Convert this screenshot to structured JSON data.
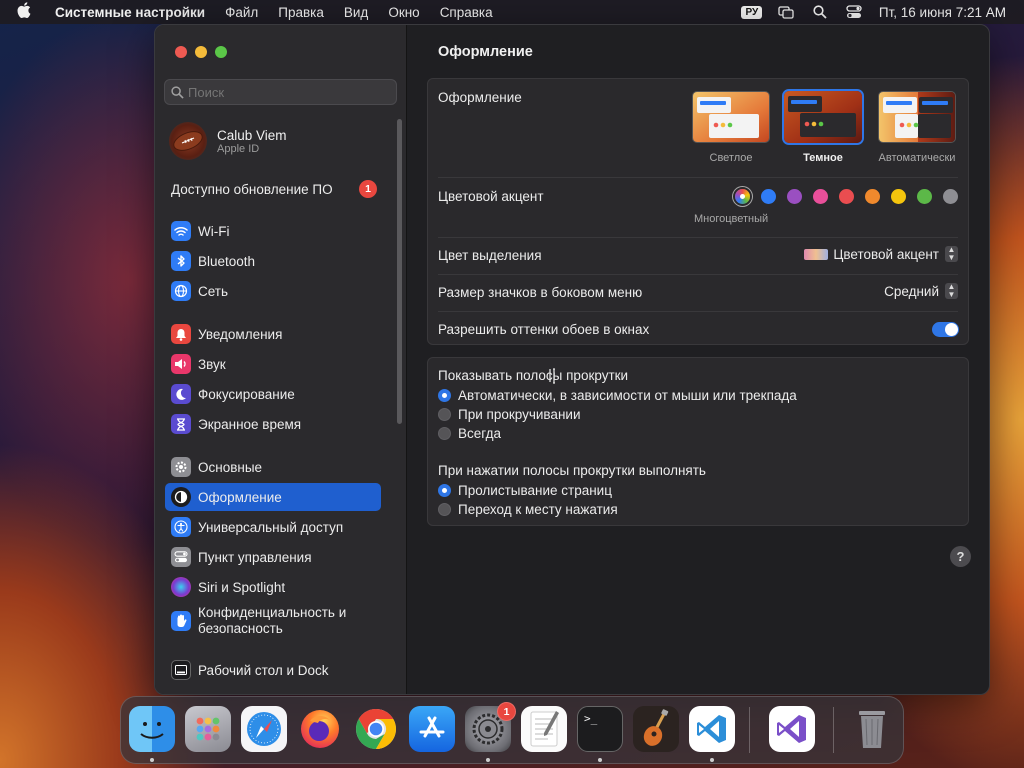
{
  "menubar": {
    "apple_icon": "apple-logo-icon",
    "app_name": "Системные настройки",
    "menus": [
      "Файл",
      "Правка",
      "Вид",
      "Окно",
      "Справка"
    ],
    "input_lang": "РУ",
    "status_icons": [
      "screen-mirroring-icon",
      "search-icon",
      "control-center-icon"
    ],
    "clock": "Пт, 16 июня  7:21 AM"
  },
  "sidebar": {
    "search_placeholder": "Поиск",
    "account": {
      "name": "Calub Viem",
      "subtitle": "Apple ID"
    },
    "update": {
      "label": "Доступно обновление ПО",
      "badge": "1"
    },
    "groups": [
      [
        {
          "label": "Wi-Fi",
          "icon": "wifi-icon",
          "color": "#2f7cf6"
        },
        {
          "label": "Bluetooth",
          "icon": "bluetooth-icon",
          "color": "#2f7cf6"
        },
        {
          "label": "Сеть",
          "icon": "globe-icon",
          "color": "#2f7cf6"
        }
      ],
      [
        {
          "label": "Уведомления",
          "icon": "bell-icon",
          "color": "#e9473f"
        },
        {
          "label": "Звук",
          "icon": "speaker-icon",
          "color": "#e9376a"
        },
        {
          "label": "Фокусирование",
          "icon": "moon-icon",
          "color": "#5a4bd0"
        },
        {
          "label": "Экранное время",
          "icon": "hourglass-icon",
          "color": "#5a4bd0"
        }
      ],
      [
        {
          "label": "Основные",
          "icon": "gear-icon",
          "color": "#8e8e93"
        },
        {
          "label": "Оформление",
          "icon": "appearance-icon",
          "color": "#1c1c1e",
          "selected": true
        },
        {
          "label": "Универсальный доступ",
          "icon": "accessibility-icon",
          "color": "#2f7cf6"
        },
        {
          "label": "Пункт управления",
          "icon": "control-center-icon",
          "color": "#8e8e93"
        },
        {
          "label": "Siri и Spotlight",
          "icon": "siri-icon",
          "color": "#7a3ad0"
        },
        {
          "label": "Конфиденциальность и безопасность",
          "icon": "hand-icon",
          "color": "#2f7cf6"
        }
      ],
      [
        {
          "label": "Рабочий стол и Dock",
          "icon": "dock-icon",
          "color": "#1c1c1e"
        }
      ]
    ]
  },
  "main": {
    "title": "Оформление",
    "appearance": {
      "label": "Оформление",
      "options": [
        {
          "label": "Светлое",
          "selected": false
        },
        {
          "label": "Темное",
          "selected": true
        },
        {
          "label": "Автоматически",
          "selected": false
        }
      ]
    },
    "accent": {
      "label": "Цветовой акцент",
      "selected_name": "Многоцветный",
      "colors": [
        "multicolor",
        "#2f7cf6",
        "#9a4fc1",
        "#e94f9a",
        "#ea4d50",
        "#f0892d",
        "#f5c50d",
        "#5cb848",
        "#8e8e93"
      ]
    },
    "highlight": {
      "label": "Цвет выделения",
      "value": "Цветовой акцент"
    },
    "sidebar_icon_size": {
      "label": "Размер значков в боковом меню",
      "value": "Средний"
    },
    "wallpaper_tint": {
      "label": "Разрешить оттенки обоев в окнах",
      "enabled": true
    },
    "scrollbars": {
      "label": "Показывать полосы прокрутки",
      "options": [
        {
          "label": "Автоматически, в зависимости от мыши или трекпада",
          "selected": true
        },
        {
          "label": "При прокручивании",
          "selected": false
        },
        {
          "label": "Всегда",
          "selected": false
        }
      ]
    },
    "click_scrollbar": {
      "label": "При нажатии полосы прокрутки выполнять",
      "options": [
        {
          "label": "Пролистывание страниц",
          "selected": true
        },
        {
          "label": "Переход к месту нажатия",
          "selected": false
        }
      ]
    },
    "help_label": "?"
  },
  "dock": {
    "apps": [
      {
        "name": "Finder",
        "icon": "finder-icon"
      },
      {
        "name": "Launchpad",
        "icon": "launchpad-icon"
      },
      {
        "name": "Safari",
        "icon": "safari-icon"
      },
      {
        "name": "Firefox",
        "icon": "firefox-icon"
      },
      {
        "name": "Chrome",
        "icon": "chrome-icon"
      },
      {
        "name": "App Store",
        "icon": "app-store-icon"
      },
      {
        "name": "System Settings",
        "icon": "system-settings-icon",
        "badge": "1"
      },
      {
        "name": "TextEdit",
        "icon": "textedit-icon"
      },
      {
        "name": "Terminal",
        "icon": "terminal-icon"
      },
      {
        "name": "GarageBand",
        "icon": "guitar-icon"
      },
      {
        "name": "Visual Studio Code",
        "icon": "vscode-icon"
      },
      {
        "name": "Visual Studio",
        "icon": "visual-studio-icon"
      },
      {
        "name": "Trash",
        "icon": "trash-icon"
      }
    ],
    "terminal_prompt": ">_"
  }
}
